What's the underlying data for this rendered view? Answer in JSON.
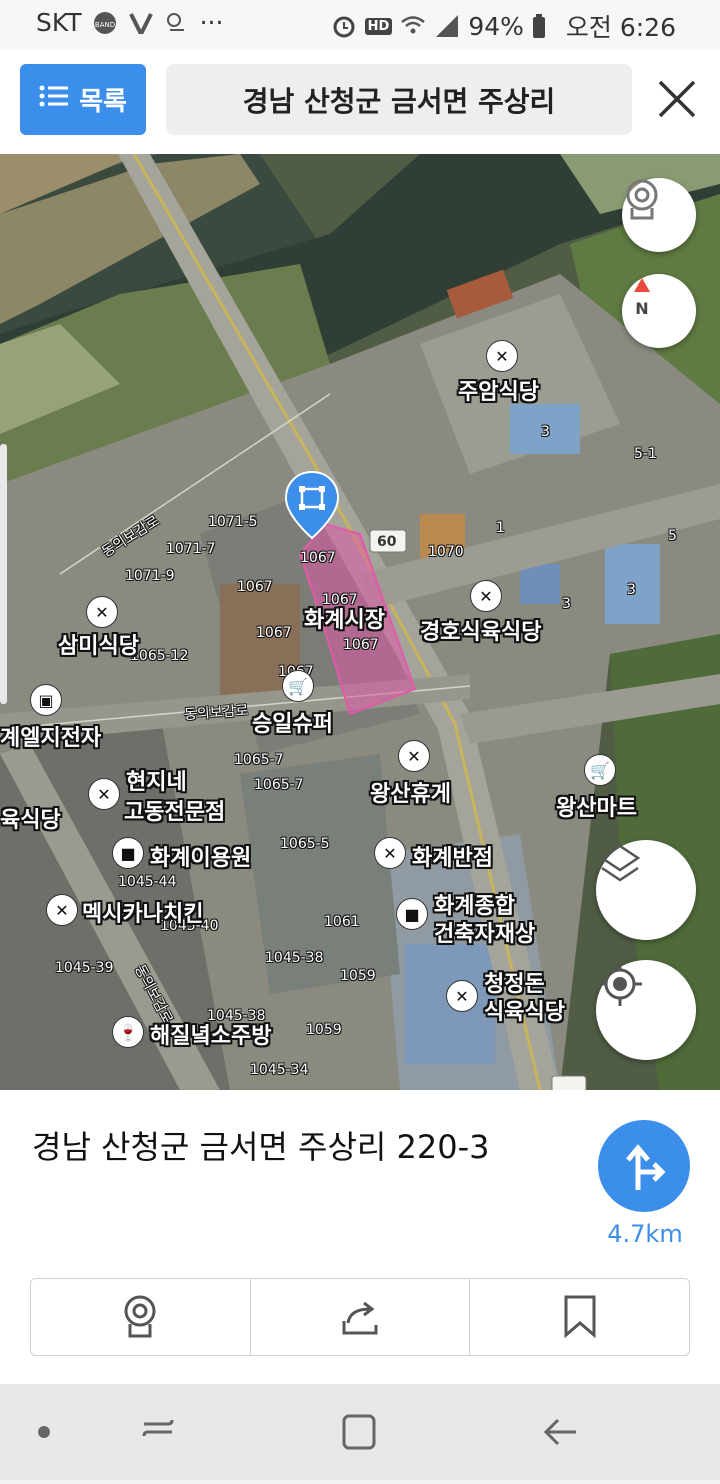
{
  "status_bar": {
    "carrier": "SKT",
    "battery": "94%",
    "time": "오전 6:26",
    "hd_label": "HD"
  },
  "header": {
    "list_button": "목록",
    "search_query": "경남 산청군 금서면 주상리"
  },
  "map": {
    "road_labels": [
      "동의보감로",
      "동의보감로",
      "동의보감로"
    ],
    "road_number": "60",
    "pois": [
      "주암식당",
      "화계시장",
      "경호식육식당",
      "삼미식당",
      "승일슈퍼",
      "계엘지전자",
      "현지네",
      "고동전문점",
      "왕산휴게",
      "왕산마트",
      "육식당",
      "화계이용원",
      "화계반점",
      "멕시카나치킨",
      "화계종합",
      "건축자재상",
      "청정돈",
      "식육식당",
      "해질녘소주방"
    ],
    "lots": [
      "1071-5",
      "1071-7",
      "1071-9",
      "1067",
      "1067",
      "1067",
      "1067",
      "1067",
      "1070",
      "1065-12",
      "1065-7",
      "1065-7",
      "1065-5",
      "1045-44",
      "1045-40",
      "1061",
      "1045-38",
      "1059",
      "1045-39",
      "1045-38",
      "1059",
      "1045-34",
      "3",
      "1",
      "5-1",
      "5",
      "3",
      "3"
    ],
    "marker_label": "1067"
  },
  "panel": {
    "address": "경남 산청군 금서면 주상리 220-3",
    "distance": "4.7km"
  },
  "colors": {
    "accent": "#3b8eea",
    "parcel_highlight": "#e05aa8"
  }
}
